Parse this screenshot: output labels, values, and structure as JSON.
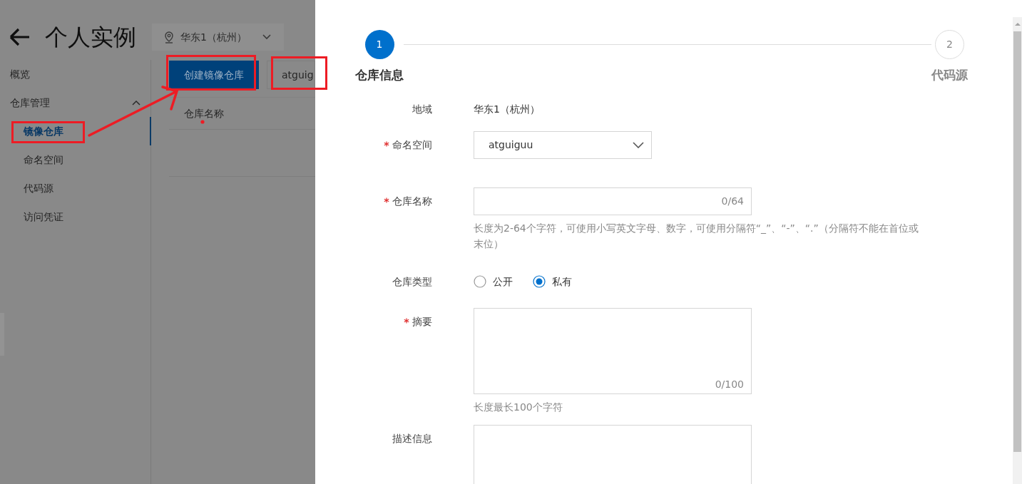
{
  "header": {
    "title": "个人实例",
    "region": "华东1（杭州）"
  },
  "sidebar": {
    "items": [
      {
        "label": "概览",
        "selected": false
      },
      {
        "label": "仓库管理",
        "expanded": true,
        "children": [
          {
            "label": "镜像仓库",
            "selected": true
          },
          {
            "label": "命名空间",
            "selected": false
          },
          {
            "label": "代码源",
            "selected": false
          },
          {
            "label": "访问凭证",
            "selected": false
          }
        ]
      }
    ]
  },
  "toolbar": {
    "create_button": "创建镜像仓库",
    "namespace_value": "atguig"
  },
  "table": {
    "columns": [
      "仓库名称"
    ]
  },
  "steps": [
    {
      "number": "1",
      "label": "仓库信息",
      "selected": true
    },
    {
      "number": "2",
      "label": "代码源",
      "selected": false
    }
  ],
  "form": {
    "fields": [
      {
        "kind": "text",
        "label": "地域",
        "required": false,
        "value": "华东1（杭州）"
      },
      {
        "kind": "select",
        "label": "命名空间",
        "required": true,
        "value": "atguiguu"
      },
      {
        "kind": "input",
        "label": "仓库名称",
        "required": true,
        "counter": "0/64",
        "help": "长度为2-64个字符，可使用小写英文字母、数字，可使用分隔符“_”、“-”、“.”（分隔符不能在首位或末位）"
      },
      {
        "kind": "radio",
        "label": "仓库类型",
        "required": false,
        "options": [
          {
            "label": "公开",
            "selected": false
          },
          {
            "label": "私有",
            "selected": true
          }
        ]
      },
      {
        "kind": "textarea",
        "label": "摘要",
        "required": true,
        "counter": "0/100",
        "help": "长度最长100个字符"
      },
      {
        "kind": "textarea",
        "label": "描述信息",
        "required": false
      }
    ]
  }
}
